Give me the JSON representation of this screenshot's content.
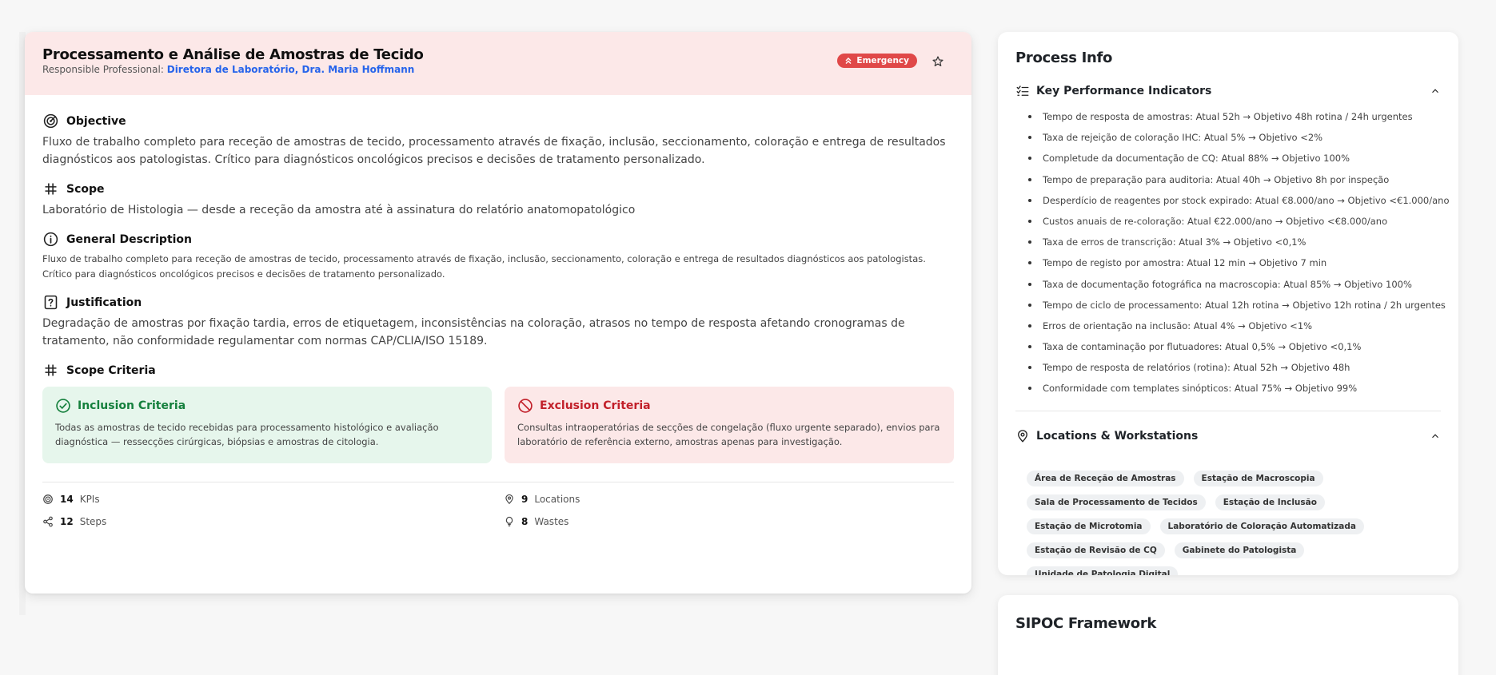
{
  "process": {
    "title": "Processamento e Análise de Amostras de Tecido",
    "responsible_label": "Responsible Professional:",
    "responsible_name": "Diretora de Laboratório, Dra. Maria Hoffmann",
    "badge": "Emergency"
  },
  "objective": {
    "heading": "Objective",
    "text": "Fluxo de trabalho completo para receção de amostras de tecido, processamento através de fixação, inclusão, seccionamento, coloração e entrega de resultados diagnósticos aos patologistas. Crítico para diagnósticos oncológicos precisos e decisões de tratamento personalizado."
  },
  "scope": {
    "heading": "Scope",
    "text": "Laboratório de Histologia — desde a receção da amostra até à assinatura do relatório anatomopatológico"
  },
  "general_description": {
    "heading": "General Description",
    "text": "Fluxo de trabalho completo para receção de amostras de tecido, processamento através de fixação, inclusão, seccionamento, coloração e entrega de resultados diagnósticos aos patologistas. Crítico para diagnósticos oncológicos precisos e decisões de tratamento personalizado."
  },
  "justification": {
    "heading": "Justification",
    "text": "Degradação de amostras por fixação tardia, erros de etiquetagem, inconsistências na coloração, atrasos no tempo de resposta afetando cronogramas de tratamento, não conformidade regulamentar com normas CAP/CLIA/ISO 15189."
  },
  "scope_criteria": {
    "heading": "Scope Criteria",
    "inclusion_heading": "Inclusion Criteria",
    "inclusion_text": "Todas as amostras de tecido recebidas para processamento histológico e avaliação diagnóstica — ressecções cirúrgicas, biópsias e amostras de citologia.",
    "exclusion_heading": "Exclusion Criteria",
    "exclusion_text": "Consultas intraoperatórias de secções de congelação (fluxo urgente separado), envios para laboratório de referência externo, amostras apenas para investigação."
  },
  "stats": {
    "kpis_count": "14",
    "kpis_label": "KPIs",
    "locations_count": "9",
    "locations_label": "Locations",
    "steps_count": "12",
    "steps_label": "Steps",
    "wastes_count": "8",
    "wastes_label": "Wastes"
  },
  "process_info": {
    "title": "Process Info",
    "kpi_heading": "Key Performance Indicators",
    "kpis": [
      "Tempo de resposta de amostras: Atual 52h → Objetivo 48h rotina / 24h urgentes",
      "Taxa de rejeição de coloração IHC: Atual 5% → Objetivo <2%",
      "Completude da documentação de CQ: Atual 88% → Objetivo 100%",
      "Tempo de preparação para auditoria: Atual 40h → Objetivo 8h por inspeção",
      "Desperdício de reagentes por stock expirado: Atual €8.000/ano → Objetivo <€1.000/ano",
      "Custos anuais de re-coloração: Atual €22.000/ano → Objetivo <€8.000/ano",
      "Taxa de erros de transcrição: Atual 3% → Objetivo <0,1%",
      "Tempo de registo por amostra: Atual 12 min → Objetivo 7 min",
      "Taxa de documentação fotográfica na macroscopia: Atual 85% → Objetivo 100%",
      "Tempo de ciclo de processamento: Atual 12h rotina → Objetivo 12h rotina / 2h urgentes",
      "Erros de orientação na inclusão: Atual 4% → Objetivo <1%",
      "Taxa de contaminação por flutuadores: Atual 0,5% → Objetivo <0,1%",
      "Tempo de resposta de relatórios (rotina): Atual 52h → Objetivo 48h",
      "Conformidade com templates sinópticos: Atual 75% → Objetivo 99%"
    ],
    "locations_heading": "Locations & Workstations",
    "locations": [
      "Área de Receção de Amostras",
      "Estação de Macroscopia",
      "Sala de Processamento de Tecidos",
      "Estação de Inclusão",
      "Estação de Microtomia",
      "Laboratório de Coloração Automatizada",
      "Estação de Revisão de CQ",
      "Gabinete do Patologista",
      "Unidade de Patologia Digital"
    ]
  },
  "sipoc": {
    "title": "SIPOC Framework"
  },
  "colors": {
    "emergency": "#e04848",
    "inclusion": "#15803d",
    "exclusion": "#c2202a",
    "link": "#2563eb"
  }
}
